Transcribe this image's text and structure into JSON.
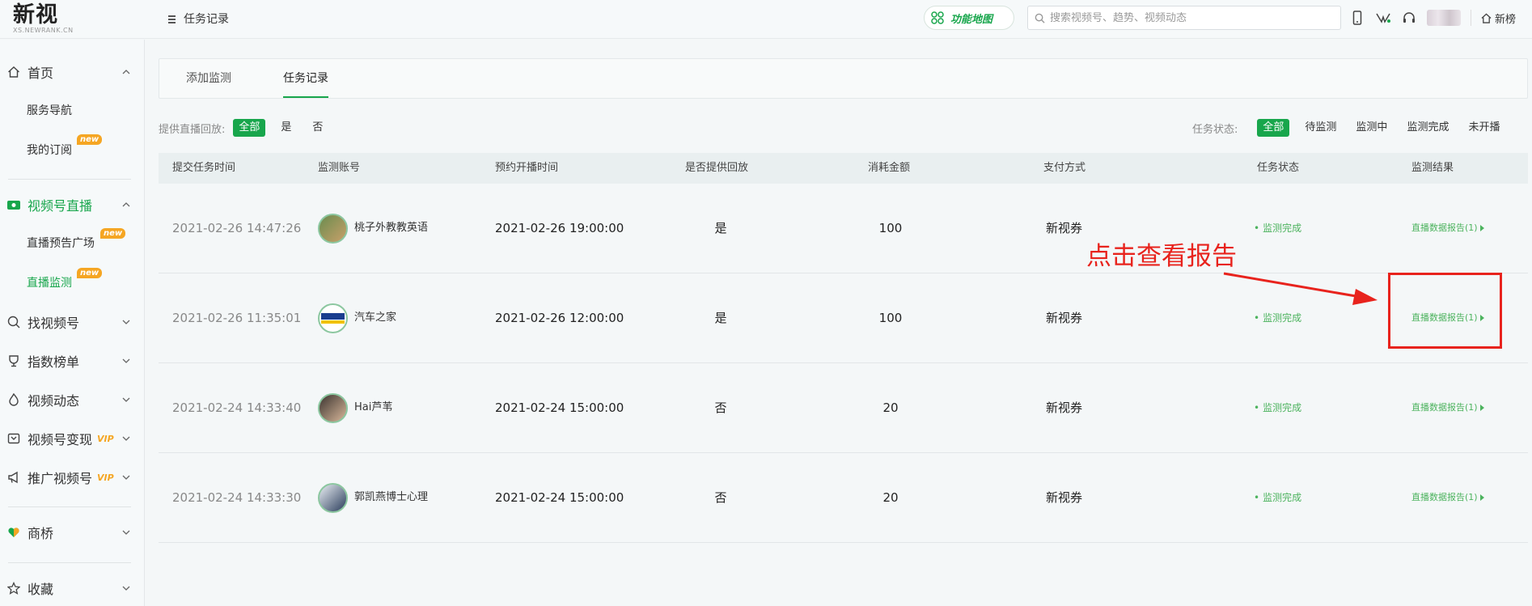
{
  "header": {
    "logo_text": "新视",
    "logo_sub": "XS.NEWRANK.CN",
    "page_title": "任务记录",
    "func_map_label": "功能地图",
    "search_placeholder": "搜索视频号、趋势、视频动态",
    "xinbang_label": "新榜"
  },
  "sidebar": {
    "home": "首页",
    "service_nav": "服务导航",
    "my_subscription": "我的订阅",
    "live": "视频号直播",
    "live_preview": "直播预告广场",
    "live_monitor": "直播监测",
    "find_channel": "找视频号",
    "index_rank": "指数榜单",
    "video_dynamic": "视频动态",
    "monetize": "视频号变现",
    "promote": "推广视频号",
    "shangqiao": "商桥",
    "favorites": "收藏",
    "new_badge": "new",
    "vip_badge": "VIP"
  },
  "tabs": {
    "add_monitor": "添加监测",
    "task_record": "任务记录"
  },
  "filters": {
    "replay_label": "提供直播回放:",
    "replay_options": [
      "全部",
      "是",
      "否"
    ],
    "status_label": "任务状态:",
    "status_options": [
      "全部",
      "待监测",
      "监测中",
      "监测完成",
      "未开播"
    ]
  },
  "table": {
    "headers": [
      "提交任务时间",
      "监测账号",
      "预约开播时间",
      "是否提供回放",
      "消耗金额",
      "支付方式",
      "任务状态",
      "监测结果"
    ],
    "rows": [
      {
        "submit_time": "2021-02-26 14:47:26",
        "account": "桃子外教教英语",
        "scheduled": "2021-02-26 19:00:00",
        "replay": "是",
        "amount": "100",
        "payment": "新视券",
        "status": "监测完成",
        "result": "直播数据报告(1)"
      },
      {
        "submit_time": "2021-02-26 11:35:01",
        "account": "汽车之家",
        "scheduled": "2021-02-26 12:00:00",
        "replay": "是",
        "amount": "100",
        "payment": "新视券",
        "status": "监测完成",
        "result": "直播数据报告(1)"
      },
      {
        "submit_time": "2021-02-24 14:33:40",
        "account": "Hai芦苇",
        "scheduled": "2021-02-24 15:00:00",
        "replay": "否",
        "amount": "20",
        "payment": "新视券",
        "status": "监测完成",
        "result": "直播数据报告(1)"
      },
      {
        "submit_time": "2021-02-24 14:33:30",
        "account": "郭凯燕博士心理",
        "scheduled": "2021-02-24 15:00:00",
        "replay": "否",
        "amount": "20",
        "payment": "新视券",
        "status": "监测完成",
        "result": "直播数据报告(1)"
      }
    ]
  },
  "annotation": {
    "text": "点击查看报告",
    "color": "#e8231d"
  },
  "colors": {
    "accent": "#18a64c",
    "status_green": "#4cb35e",
    "badge_orange": "#f5a623"
  }
}
